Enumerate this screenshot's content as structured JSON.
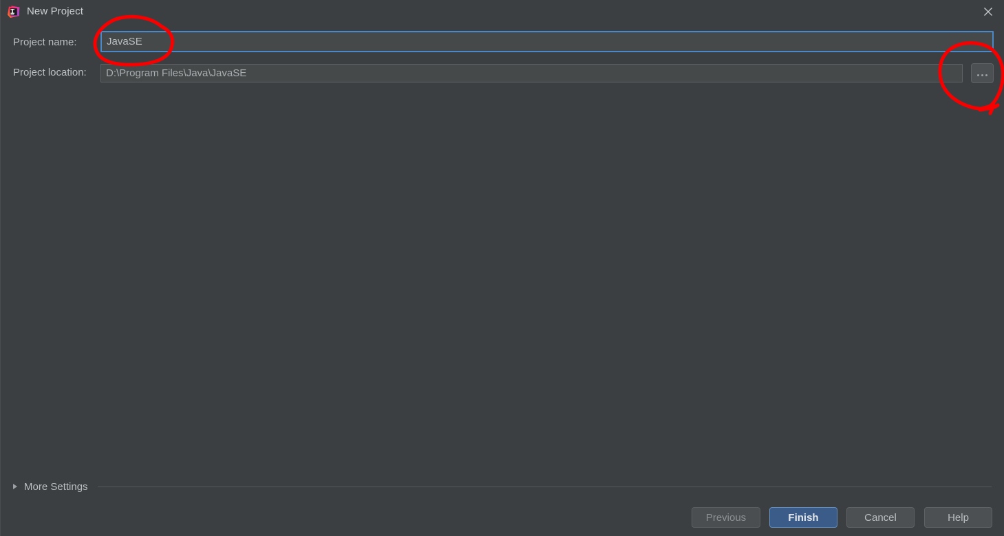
{
  "window": {
    "title": "New Project",
    "app_icon": "intellij-idea-icon",
    "close_icon": "close-icon"
  },
  "form": {
    "project_name": {
      "label": "Project name:",
      "value": "JavaSE",
      "placeholder": ""
    },
    "project_location": {
      "label": "Project location:",
      "value": "D:\\Program Files\\Java\\JavaSE",
      "placeholder": "",
      "browse_label": "..."
    }
  },
  "more_settings": {
    "label": "More Settings",
    "expanded": false,
    "arrow_icon": "triangle-right-icon"
  },
  "buttons": {
    "previous": "Previous",
    "finish": "Finish",
    "cancel": "Cancel",
    "help": "Help"
  },
  "colors": {
    "background": "#3c3f41",
    "field_background": "#45494a",
    "focus_border": "#4a88c7",
    "primary_button": "#3b5c88",
    "text": "#bbbfc2",
    "annotation": "#f90000"
  }
}
